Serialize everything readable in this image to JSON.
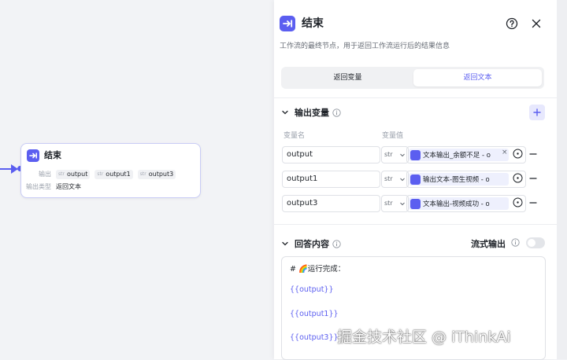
{
  "node": {
    "title": "结束",
    "output_label": "输出",
    "outputs": [
      {
        "type": "str",
        "name": "output"
      },
      {
        "type": "str",
        "name": "output1"
      },
      {
        "type": "str",
        "name": "output3"
      }
    ],
    "mode_label": "输出类型",
    "mode_value": "返回文本"
  },
  "panel": {
    "title": "结束",
    "description": "工作流的最终节点，用于返回工作流运行后的结果信息",
    "tabs": [
      {
        "label": "返回变量",
        "active": false
      },
      {
        "label": "返回文本",
        "active": true
      }
    ],
    "output_section": {
      "title": "输出变量",
      "col_name": "变量名",
      "col_value": "变量值",
      "rows": [
        {
          "name": "output",
          "type": "str",
          "value": "文本输出_余额不足 - o"
        },
        {
          "name": "output1",
          "type": "str",
          "value": "输出文本-图生视频 - o"
        },
        {
          "name": "output3",
          "type": "str",
          "value": "文本输出-视频成功 - o"
        }
      ]
    },
    "answer_section": {
      "title": "回答内容",
      "stream_label": "流式输出",
      "stream_on": false,
      "lines": [
        "# 🌈运行完成：",
        "{{output}}",
        "{{output1}}",
        "{{output3}}"
      ]
    }
  },
  "watermark": "掘金技术社区 @ iThinkAi",
  "colors": {
    "accent": "#5b5ef0",
    "canvas_bg": "#f2f3f6",
    "panel_bg": "#ffffff"
  },
  "icons": [
    "end-node-icon",
    "help-icon",
    "close-icon",
    "chevron-down-icon",
    "info-icon",
    "plus-icon",
    "minus-icon",
    "variable-ref-icon",
    "add-circle-icon"
  ]
}
